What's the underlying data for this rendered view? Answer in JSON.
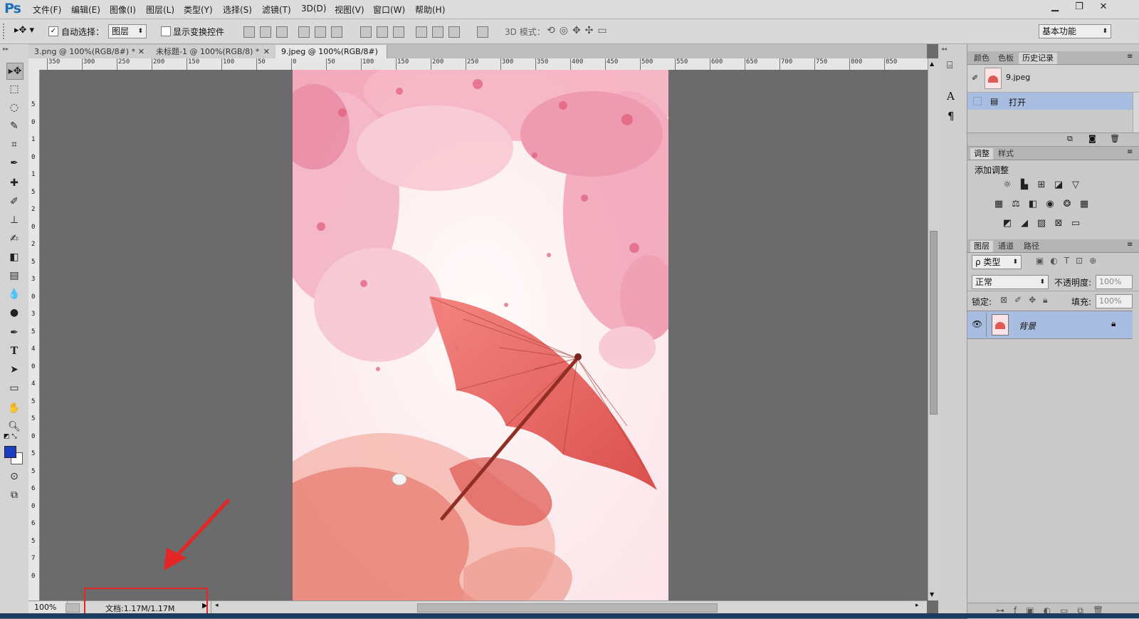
{
  "app": {
    "logo": "Ps"
  },
  "menu": [
    "文件(F)",
    "编辑(E)",
    "图像(I)",
    "图层(L)",
    "类型(Y)",
    "选择(S)",
    "滤镜(T)",
    "3D(D)",
    "视图(V)",
    "窗口(W)",
    "帮助(H)"
  ],
  "window_controls": {
    "minimize": "▁",
    "restore": "❐",
    "close": "✕"
  },
  "options": {
    "auto_select_label": "自动选择：",
    "auto_select_checked": "✓",
    "auto_select_value": "图层",
    "show_transform_label": "显示变换控件",
    "mode_3d_label": "3D 模式：",
    "workspace": "基本功能"
  },
  "tabs": [
    {
      "label": "3.png @ 100%(RGB/8#) *",
      "close": "✕"
    },
    {
      "label": "未标题-1 @ 100%(RGB/8) *",
      "close": "✕"
    },
    {
      "label": "9.jpeg @ 100%(RGB/8#)",
      "close": "✕"
    }
  ],
  "ruler_h": [
    "350",
    "300",
    "250",
    "200",
    "150",
    "100",
    "50",
    "0",
    "50",
    "100",
    "150",
    "200",
    "250",
    "300",
    "350",
    "400",
    "450",
    "500",
    "550",
    "600",
    "650",
    "700",
    "750",
    "800",
    "850"
  ],
  "ruler_v": [
    "5",
    "0",
    "1",
    "0",
    "1",
    "5",
    "2",
    "0",
    "2",
    "5",
    "3",
    "0",
    "3",
    "5",
    "4",
    "0",
    "4",
    "5",
    "5",
    "0",
    "5",
    "5",
    "6",
    "0",
    "6",
    "5",
    "7",
    "0"
  ],
  "status": {
    "zoom": "100%",
    "doc": "文档:1.17M/1.17M"
  },
  "panel_top": {
    "tabs": [
      "颜色",
      "色板",
      "历史记录"
    ],
    "active_tab": 2,
    "snapshot_label": "9.jpeg",
    "history_item": "打开"
  },
  "panel_adjust": {
    "tabs": [
      "调整",
      "样式"
    ],
    "title": "添加调整"
  },
  "panel_layers": {
    "tabs": [
      "图层",
      "通道",
      "路径"
    ],
    "filter_label": "ρ 类型",
    "blend_mode": "正常",
    "opacity_label": "不透明度:",
    "opacity_value": "100%",
    "lock_label": "锁定:",
    "fill_label": "填充:",
    "fill_value": "100%",
    "layer_name": "背景"
  },
  "colors": {
    "foreground": "#1a3fc0",
    "background": "#ffffff",
    "accent": "#e23b3b",
    "selection": "#a9bde0"
  }
}
